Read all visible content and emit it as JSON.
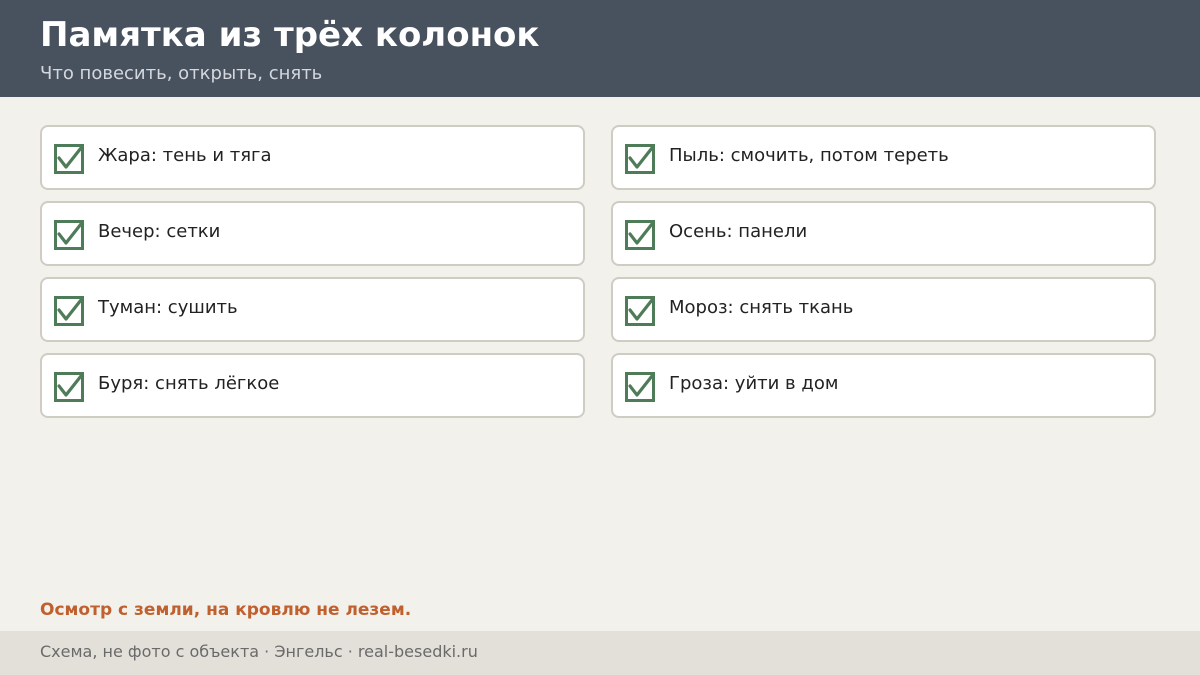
{
  "header": {
    "title": "Памятка из трёх колонок",
    "subtitle": "Что повесить, открыть, снять"
  },
  "checklist": [
    {
      "label": "Жара: тень и тяга",
      "checked": true
    },
    {
      "label": "Пыль: смочить, потом тереть",
      "checked": true
    },
    {
      "label": "Вечер: сетки",
      "checked": true
    },
    {
      "label": "Осень: панели",
      "checked": true
    },
    {
      "label": "Туман: сушить",
      "checked": true
    },
    {
      "label": "Мороз: снять ткань",
      "checked": true
    },
    {
      "label": "Буря: снять лёгкое",
      "checked": true
    },
    {
      "label": "Гроза: уйти в дом",
      "checked": true
    }
  ],
  "note": "Осмотр с земли, на кровлю не лезем.",
  "footer": {
    "text": "Схема, не фото с объекта  ·  Энгельс  ·  real-besedki.ru"
  },
  "colors": {
    "header_bg": "#48525f",
    "check_green": "#4f7c58",
    "note_orange": "#c0602e"
  },
  "icons": {
    "item": "checkbox-checked-icon"
  }
}
